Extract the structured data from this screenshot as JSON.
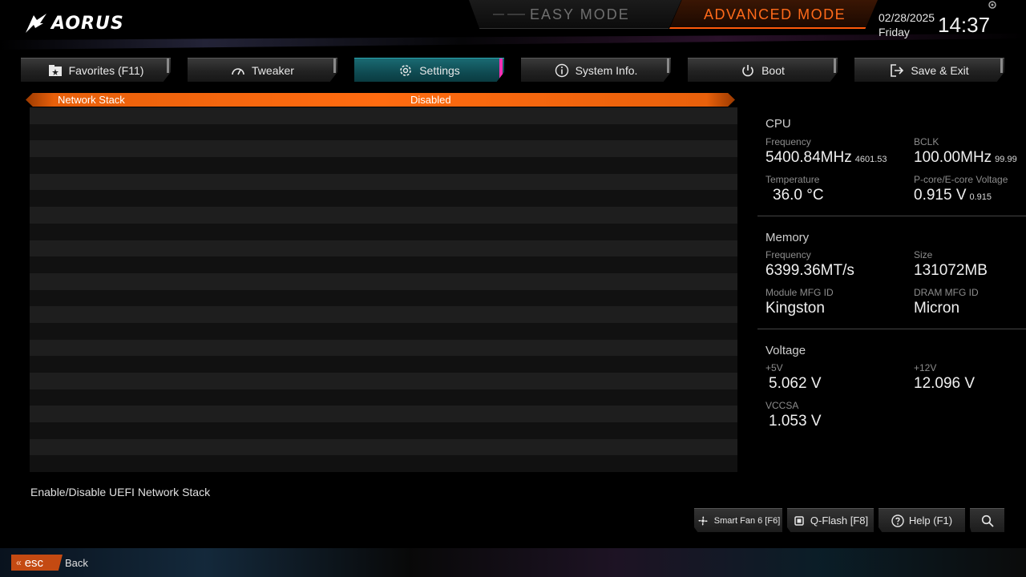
{
  "header": {
    "brand": "AORUS",
    "modes": {
      "easy": "EASY MODE",
      "advanced": "ADVANCED MODE"
    },
    "date": "02/28/2025",
    "weekday": "Friday",
    "time": "14:37"
  },
  "tabs": [
    {
      "label": "Favorites (F11)",
      "icon": "star-folder-icon",
      "active": false
    },
    {
      "label": "Tweaker",
      "icon": "speedometer-icon",
      "active": false
    },
    {
      "label": "Settings",
      "icon": "gear-icon",
      "active": true
    },
    {
      "label": "System Info.",
      "icon": "info-icon",
      "active": false
    },
    {
      "label": "Boot",
      "icon": "power-icon",
      "active": false
    },
    {
      "label": "Save & Exit",
      "icon": "exit-icon",
      "active": false
    }
  ],
  "settings": {
    "selected": {
      "name": "Network Stack",
      "value": "Disabled"
    }
  },
  "help_text": "Enable/Disable UEFI Network Stack",
  "monitor": {
    "cpu": {
      "title": "CPU",
      "frequency_label": "Frequency",
      "frequency": "5400.84MHz",
      "frequency_sub": "4601.53",
      "bclk_label": "BCLK",
      "bclk": "100.00MHz",
      "bclk_sub": "99.99",
      "temp_label": "Temperature",
      "temp": "36.0 °C",
      "voltage_label": "P-core/E-core Voltage",
      "voltage": "0.915 V",
      "voltage_sub": "0.915"
    },
    "memory": {
      "title": "Memory",
      "frequency_label": "Frequency",
      "frequency": "6399.36MT/s",
      "size_label": "Size",
      "size": "131072MB",
      "module_label": "Module MFG ID",
      "module": "Kingston",
      "dram_label": "DRAM MFG ID",
      "dram": "Micron"
    },
    "voltage": {
      "title": "Voltage",
      "v5_label": "+5V",
      "v5": "5.062 V",
      "v12_label": "+12V",
      "v12": "12.096 V",
      "vccsa_label": "VCCSA",
      "vccsa": "1.053 V"
    }
  },
  "bottom": {
    "smartfan": "Smart Fan 6 [F6]",
    "qflash": "Q-Flash [F8]",
    "help": "Help (F1)",
    "esc": "esc",
    "back": "Back"
  },
  "colors": {
    "accent_orange": "#ff6b10",
    "active_tab": "#0f4b52",
    "tab_highlight": "#ff2fb4"
  }
}
